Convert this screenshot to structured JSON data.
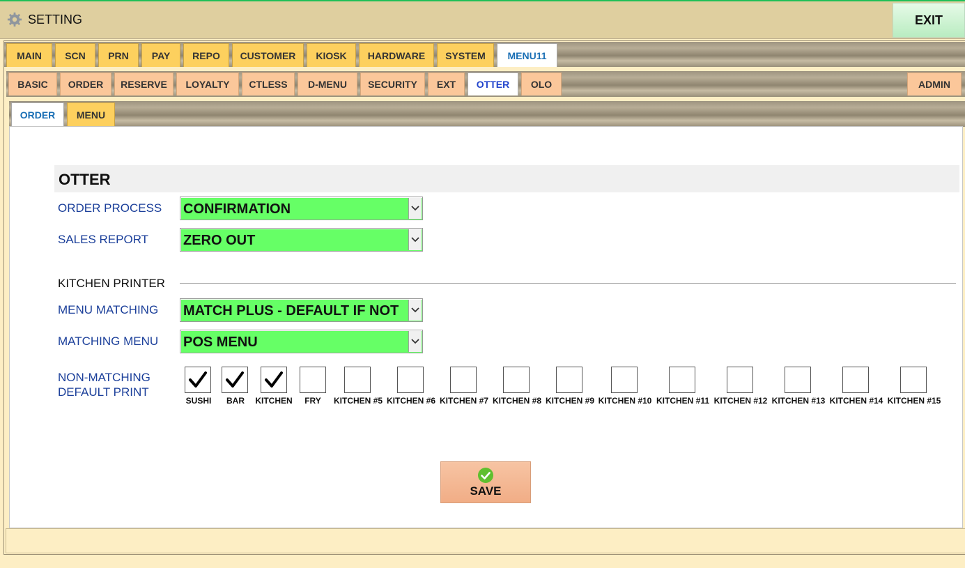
{
  "window": {
    "title": "SETTING",
    "exit_label": "EXIT"
  },
  "tabs_main": [
    "MAIN",
    "SCN",
    "PRN",
    "PAY",
    "REPO",
    "CUSTOMER",
    "KIOSK",
    "HARDWARE",
    "SYSTEM",
    "MENU11"
  ],
  "tabs_main_active": "MENU11",
  "tabs_sub": [
    "BASIC",
    "ORDER",
    "RESERVE",
    "LOYALTY",
    "CTLESS",
    "D-MENU",
    "SECURITY",
    "EXT",
    "OTTER",
    "OLO"
  ],
  "tabs_sub_active": "OTTER",
  "admin_label": "ADMIN",
  "tabs_third": [
    "ORDER",
    "MENU"
  ],
  "tabs_third_active": "ORDER",
  "section": {
    "title": "OTTER"
  },
  "fields": {
    "order_process": {
      "label": "ORDER PROCESS",
      "value": "CONFIRMATION"
    },
    "sales_report": {
      "label": "SALES REPORT",
      "value": "ZERO OUT"
    },
    "kitchen_printer_heading": "KITCHEN PRINTER",
    "menu_matching": {
      "label": "MENU MATCHING",
      "value": "MATCH PLUS - DEFAULT IF NOT"
    },
    "matching_menu": {
      "label": "MATCHING MENU",
      "value": "POS MENU"
    },
    "non_matching": {
      "label_line1": "NON-MATCHING",
      "label_line2": "DEFAULT PRINT"
    }
  },
  "printers": [
    {
      "label": "SUSHI",
      "checked": true
    },
    {
      "label": "BAR",
      "checked": true
    },
    {
      "label": "KITCHEN",
      "checked": true
    },
    {
      "label": "FRY",
      "checked": false
    },
    {
      "label": "KITCHEN #5",
      "checked": false
    },
    {
      "label": "KITCHEN #6",
      "checked": false
    },
    {
      "label": "KITCHEN #7",
      "checked": false
    },
    {
      "label": "KITCHEN #8",
      "checked": false
    },
    {
      "label": "KITCHEN #9",
      "checked": false
    },
    {
      "label": "KITCHEN #10",
      "checked": false
    },
    {
      "label": "KITCHEN #11",
      "checked": false
    },
    {
      "label": "KITCHEN #12",
      "checked": false
    },
    {
      "label": "KITCHEN #13",
      "checked": false
    },
    {
      "label": "KITCHEN #14",
      "checked": false
    },
    {
      "label": "KITCHEN #15",
      "checked": false
    }
  ],
  "save_label": "SAVE",
  "colors": {
    "select_bg": "#66ff66",
    "tab": "#fdd05e",
    "subtab": "#fbc79a",
    "active_tab_text": "#1a6fb5"
  },
  "icons": {
    "title": "gear-icon",
    "dropdown": "chevron-down-icon",
    "checkbox": "checkmark-icon",
    "save": "check-circle-icon"
  }
}
